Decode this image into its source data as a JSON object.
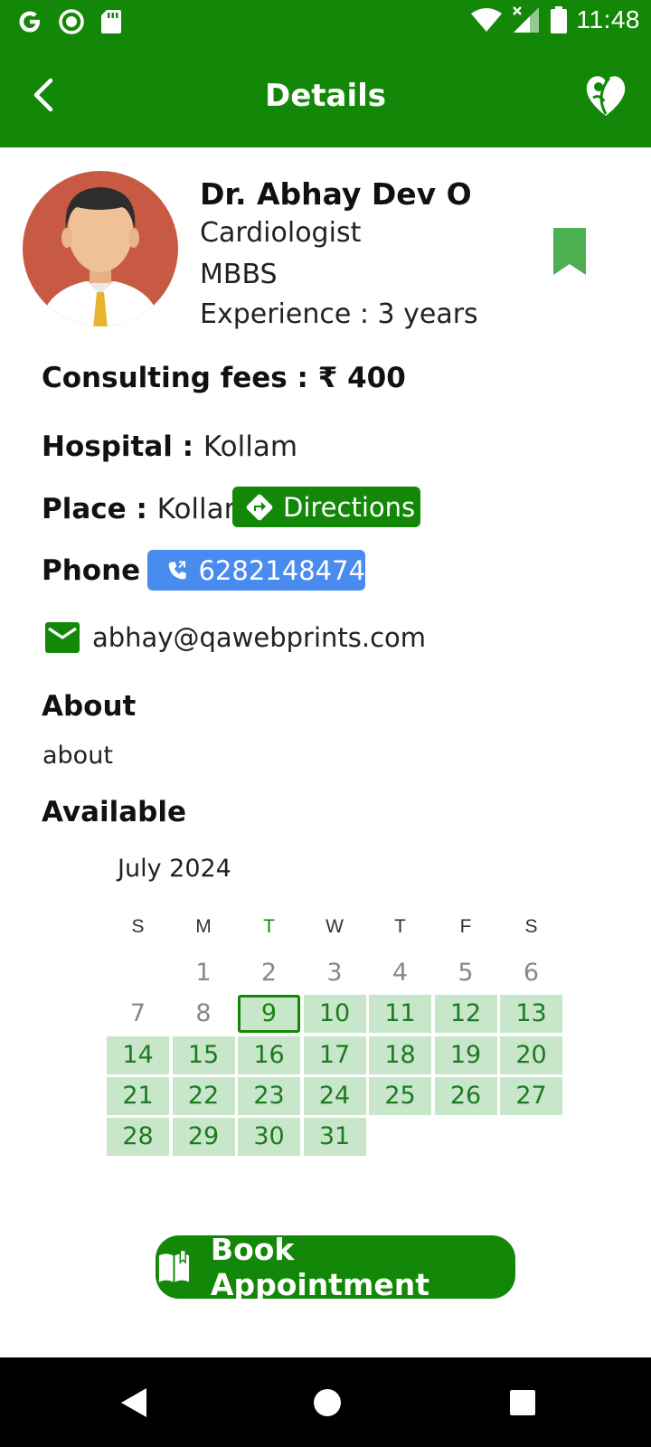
{
  "status_bar": {
    "time": "11:48",
    "left_icons": [
      "google-icon",
      "record-icon",
      "sd-card-icon"
    ],
    "right_icons": [
      "wifi-icon",
      "signal-icon",
      "battery-icon"
    ]
  },
  "app_bar": {
    "title": "Details",
    "back_icon": "chevron-left-icon",
    "logo_icon": "heart-leaf-logo-icon"
  },
  "doctor": {
    "name": "Dr. Abhay Dev O",
    "specialty": "Cardiologist",
    "qualification": "MBBS",
    "experience": "Experience : 3 years",
    "bookmark_icon": "bookmark-icon"
  },
  "details": {
    "fees_label": "Consulting fees : ",
    "fees_value": "₹ 400",
    "hospital_label": "Hospital : ",
    "hospital_value": "Kollam",
    "place_label": "Place : ",
    "place_value": "Kollam",
    "directions_label": "Directions",
    "phone_label": "Phone : ",
    "phone_value": "6282148474",
    "email": "abhay@qawebprints.com"
  },
  "about": {
    "heading": "About",
    "text": "about"
  },
  "availability": {
    "heading": "Available",
    "month": "July 2024",
    "weekdays": [
      "S",
      "M",
      "T",
      "W",
      "T",
      "F",
      "S"
    ],
    "today_weekday_index": 2,
    "today": 9,
    "weeks": [
      [
        null,
        1,
        2,
        3,
        4,
        5,
        6
      ],
      [
        7,
        8,
        9,
        10,
        11,
        12,
        13
      ],
      [
        14,
        15,
        16,
        17,
        18,
        19,
        20
      ],
      [
        21,
        22,
        23,
        24,
        25,
        26,
        27
      ],
      [
        28,
        29,
        30,
        31,
        null,
        null,
        null
      ]
    ],
    "available_from": 9
  },
  "actions": {
    "book_label": "Book Appointment"
  },
  "colors": {
    "primary_green": "#138808",
    "available_cell": "#c8e6c9",
    "phone_blue": "#4a8bf0"
  }
}
